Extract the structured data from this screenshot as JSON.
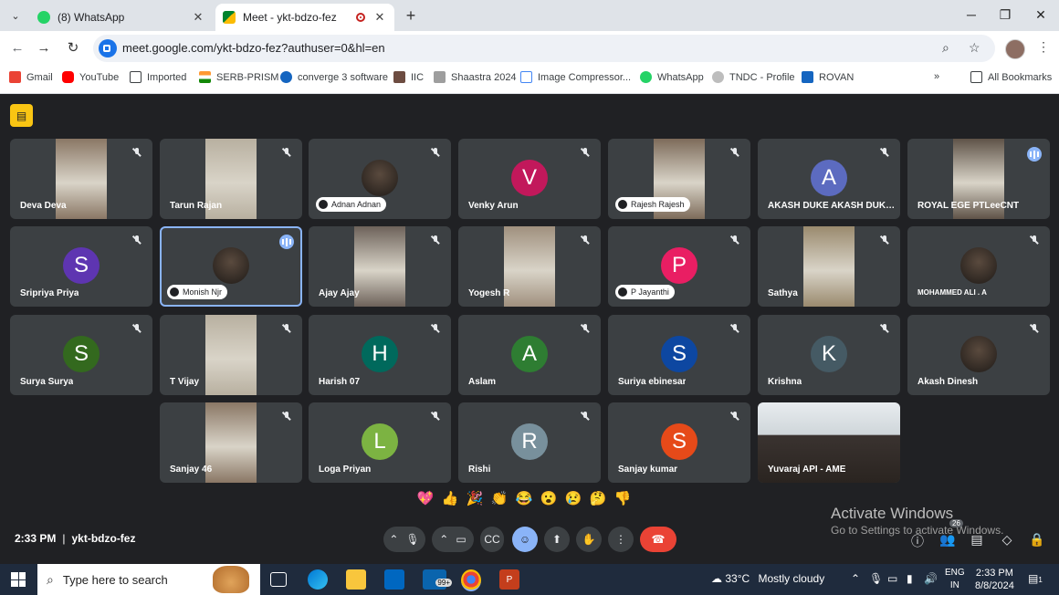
{
  "browser": {
    "tabs": [
      {
        "title": "(8) WhatsApp",
        "close": "✕"
      },
      {
        "title": "Meet - ykt-bdzo-fez",
        "close": "✕"
      }
    ],
    "url": "meet.google.com/ykt-bdzo-fez?authuser=0&hl=en",
    "bookmarks": [
      "Gmail",
      "YouTube",
      "Imported",
      "SERB-PRISM",
      "converge 3 software",
      "IIC",
      "Shaastra 2024",
      "Image Compressor...",
      "WhatsApp",
      "TNDC - Profile",
      "ROVAN"
    ],
    "all_bookmarks": "All Bookmarks",
    "more_bookmarks": "»"
  },
  "meet": {
    "tiles": [
      {
        "name": "Deva Deva",
        "type": "photo"
      },
      {
        "name": "Tarun Rajan",
        "type": "photo"
      },
      {
        "name": "Adnan Adnan",
        "type": "avatar-photo",
        "chip": true
      },
      {
        "name": "Venky Arun",
        "type": "letter",
        "letter": "V",
        "color": "#c2185b"
      },
      {
        "name": "Rajesh Rajesh",
        "type": "photo",
        "chip": true
      },
      {
        "name": "AKASH DUKE AKASH DUKE ...",
        "type": "letter",
        "letter": "A",
        "color": "#5c6bc0"
      },
      {
        "name": "ROYAL EGE PTLeeCNT",
        "type": "photo",
        "speaking": true
      },
      {
        "name": "Sripriya Priya",
        "type": "letter",
        "letter": "S",
        "color": "#5e35b1"
      },
      {
        "name": "Monish Njr",
        "type": "avatar-photo",
        "chip": true,
        "speaking": true
      },
      {
        "name": "Ajay Ajay",
        "type": "photo"
      },
      {
        "name": "Yogesh R",
        "type": "photo"
      },
      {
        "name": "P Jayanthi",
        "type": "letter",
        "letter": "P",
        "color": "#e91e63",
        "chip": true
      },
      {
        "name": "Sathya",
        "type": "photo"
      },
      {
        "name": "MOHAMMED ALI . A",
        "type": "avatar-photo"
      },
      {
        "name": "Surya Surya",
        "type": "letter",
        "letter": "S",
        "color": "#33691e"
      },
      {
        "name": "T Vijay",
        "type": "photo"
      },
      {
        "name": "Harish 07",
        "type": "letter",
        "letter": "H",
        "color": "#00695c"
      },
      {
        "name": "Aslam",
        "type": "letter",
        "letter": "A",
        "color": "#2e7d32"
      },
      {
        "name": "Suriya ebinesar",
        "type": "letter",
        "letter": "S",
        "color": "#0d47a1"
      },
      {
        "name": "Krishna",
        "type": "letter",
        "letter": "K",
        "color": "#455a64"
      },
      {
        "name": "Akash Dinesh",
        "type": "avatar-photo"
      },
      {
        "name": "Sanjay 46",
        "type": "photo"
      },
      {
        "name": "Loga Priyan",
        "type": "letter",
        "letter": "L",
        "color": "#7cb342"
      },
      {
        "name": "Rishi",
        "type": "letter",
        "letter": "R",
        "color": "#78909c"
      },
      {
        "name": "Sanjay kumar",
        "type": "letter",
        "letter": "S",
        "color": "#e64a19"
      },
      {
        "name": "Yuvaraj API - AME",
        "type": "photo",
        "selfview": true
      }
    ],
    "reactions": [
      "💖",
      "👍",
      "🎉",
      "👏",
      "😂",
      "😮",
      "😢",
      "🤔",
      "👎"
    ],
    "time": "2:33 PM",
    "meeting_code": "ykt-bdzo-fez",
    "participant_count": "26",
    "watermark_title": "Activate Windows",
    "watermark_sub": "Go to Settings to activate Windows."
  },
  "taskbar": {
    "search_placeholder": "Type here to search",
    "badge": "99+",
    "weather_temp": "33°C",
    "weather_text": "Mostly cloudy",
    "lang_line1": "ENG",
    "lang_line2": "IN",
    "clock_time": "2:33 PM",
    "clock_date": "8/8/2024",
    "notif_count": "1"
  }
}
